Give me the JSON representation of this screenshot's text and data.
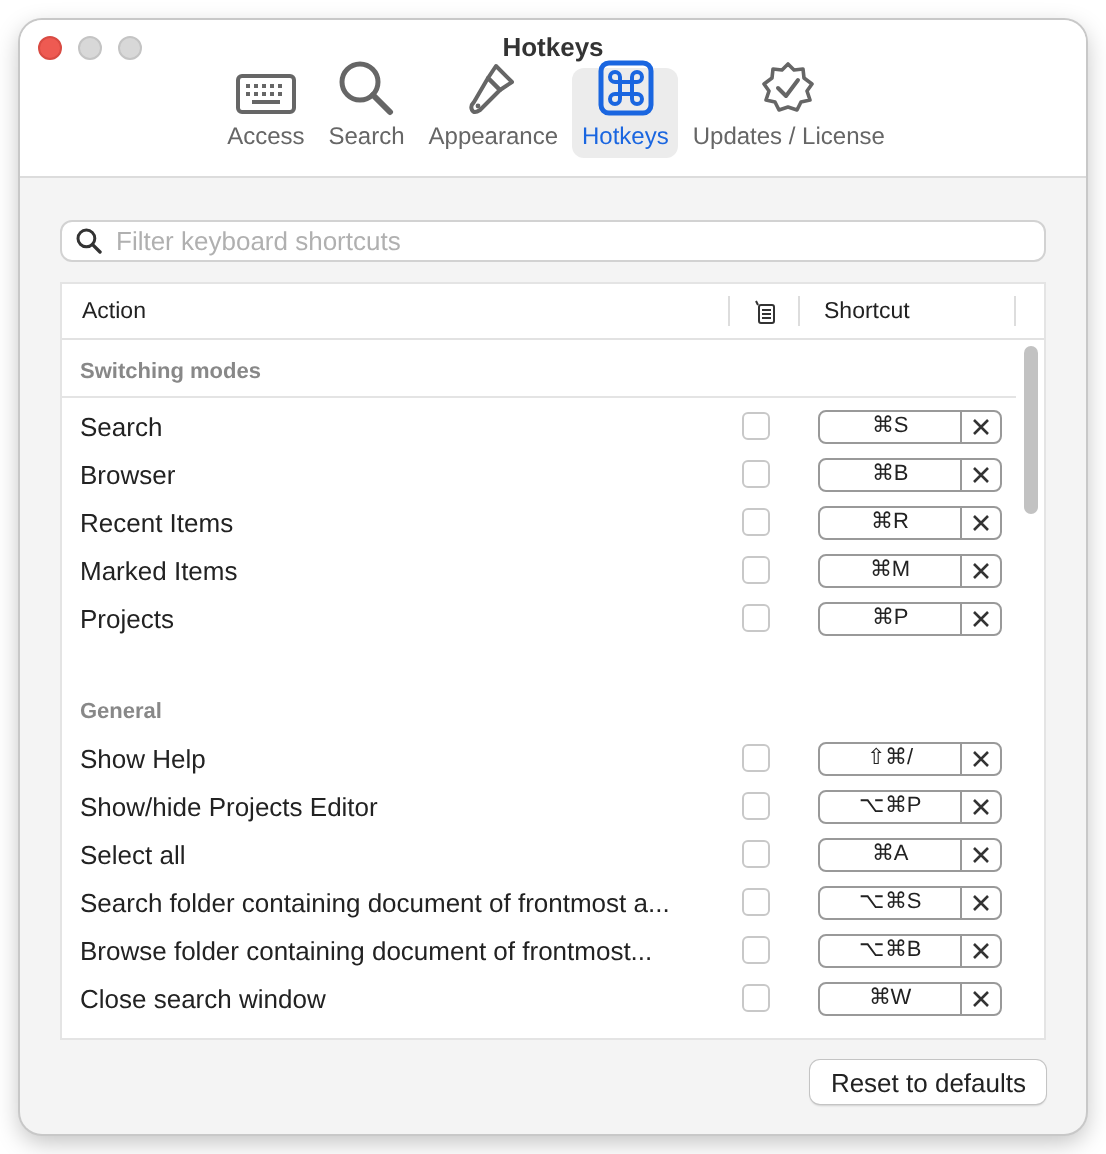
{
  "window": {
    "title": "Hotkeys"
  },
  "tabs": [
    {
      "label": "Access",
      "kind": "keyboard",
      "selected": false
    },
    {
      "label": "Search",
      "kind": "magnifier",
      "selected": false
    },
    {
      "label": "Appearance",
      "kind": "brush",
      "selected": false
    },
    {
      "label": "Hotkeys",
      "kind": "command",
      "selected": true
    },
    {
      "label": "Updates / License",
      "kind": "badge",
      "selected": false
    }
  ],
  "filter": {
    "placeholder": "Filter keyboard shortcuts"
  },
  "table": {
    "columns": {
      "action": "Action",
      "shortcut": "Shortcut"
    },
    "groups": [
      {
        "title": "Switching modes",
        "rows": [
          {
            "action": "Search",
            "checked": false,
            "shortcut": "⌘S"
          },
          {
            "action": "Browser",
            "checked": false,
            "shortcut": "⌘B"
          },
          {
            "action": "Recent Items",
            "checked": false,
            "shortcut": "⌘R"
          },
          {
            "action": "Marked Items",
            "checked": false,
            "shortcut": "⌘M"
          },
          {
            "action": "Projects",
            "checked": false,
            "shortcut": "⌘P"
          }
        ]
      },
      {
        "title": "General",
        "rows": [
          {
            "action": "Show Help",
            "checked": false,
            "shortcut": "⇧⌘/"
          },
          {
            "action": "Show/hide Projects Editor",
            "checked": false,
            "shortcut": "⌥⌘P"
          },
          {
            "action": "Select all",
            "checked": false,
            "shortcut": "⌘A"
          },
          {
            "action": "Search folder containing document of frontmost a...",
            "checked": false,
            "shortcut": "⌥⌘S"
          },
          {
            "action": "Browse folder containing document of frontmost...",
            "checked": false,
            "shortcut": "⌥⌘B"
          },
          {
            "action": "Close search window",
            "checked": false,
            "shortcut": "⌘W"
          }
        ]
      }
    ]
  },
  "reset_button": "Reset to defaults"
}
